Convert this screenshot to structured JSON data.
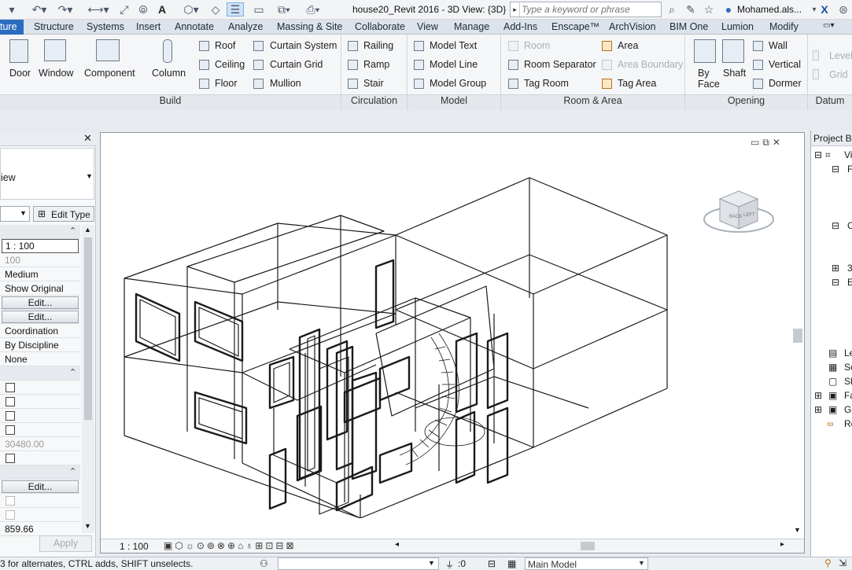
{
  "app": {
    "document_title": "house20_Revit 2016 - 3D View: {3D}",
    "search_placeholder": "Type a keyword or phrase",
    "user_name": "Mohamed.als..."
  },
  "tabs": [
    {
      "label": "ture",
      "active": true
    },
    {
      "label": "Structure"
    },
    {
      "label": "Systems"
    },
    {
      "label": "Insert"
    },
    {
      "label": "Annotate"
    },
    {
      "label": "Analyze"
    },
    {
      "label": "Massing & Site"
    },
    {
      "label": "Collaborate"
    },
    {
      "label": "View"
    },
    {
      "label": "Manage"
    },
    {
      "label": "Add-Ins"
    },
    {
      "label": "Enscape™"
    },
    {
      "label": "ArchVision"
    },
    {
      "label": "BIM One"
    },
    {
      "label": "Lumion"
    },
    {
      "label": "Modify"
    }
  ],
  "ribbon": {
    "build": {
      "title": "Build",
      "large": [
        "Door",
        "Window",
        "Component",
        "Column"
      ],
      "small_a": [
        "Roof",
        "Ceiling",
        "Floor"
      ],
      "small_b": [
        "Curtain System",
        "Curtain Grid",
        "Mullion"
      ]
    },
    "circulation": {
      "title": "Circulation",
      "items": [
        "Railing",
        "Ramp",
        "Stair"
      ]
    },
    "model": {
      "title": "Model",
      "items": [
        "Model Text",
        "Model Line",
        "Model Group"
      ]
    },
    "room_area": {
      "title": "Room & Area",
      "items_a": [
        "Room",
        "Room Separator",
        "Tag Room"
      ],
      "items_b": [
        "Area",
        "Area Boundary",
        "Tag Area"
      ]
    },
    "opening": {
      "title": "Opening",
      "large": [
        "By Face",
        "Shaft"
      ],
      "small": [
        "Wall",
        "Vertical",
        "Dormer"
      ]
    },
    "datum": {
      "title": "Datum",
      "items": [
        "Level",
        "Grid"
      ]
    }
  },
  "properties": {
    "type_label": "iew",
    "edit_type": "Edit Type",
    "rows": [
      {
        "kind": "group"
      },
      {
        "kind": "boxed",
        "value": "1 : 100"
      },
      {
        "kind": "text",
        "value": "100",
        "gray": true
      },
      {
        "kind": "text",
        "value": "Medium"
      },
      {
        "kind": "text",
        "value": "Show Original"
      },
      {
        "kind": "button",
        "value": "Edit..."
      },
      {
        "kind": "button",
        "value": "Edit..."
      },
      {
        "kind": "text",
        "value": "Coordination"
      },
      {
        "kind": "text",
        "value": "By Discipline"
      },
      {
        "kind": "text",
        "value": "None"
      },
      {
        "kind": "group"
      },
      {
        "kind": "check"
      },
      {
        "kind": "check"
      },
      {
        "kind": "check"
      },
      {
        "kind": "check"
      },
      {
        "kind": "text",
        "value": "30480.00",
        "gray": true
      },
      {
        "kind": "check"
      },
      {
        "kind": "group"
      },
      {
        "kind": "button",
        "value": "Edit..."
      },
      {
        "kind": "check",
        "dim": true
      },
      {
        "kind": "check",
        "dim": true
      },
      {
        "kind": "text",
        "value": "859.66"
      }
    ],
    "apply": "Apply"
  },
  "view": {
    "scale": "1 : 100",
    "viewcube": {
      "face_back": "BACK",
      "face_left": "LEFT"
    }
  },
  "browser": {
    "title": "Project Br",
    "items": [
      "Vi",
      "F",
      "C",
      "3",
      "E",
      "Le",
      "Sc",
      "Sh",
      "Fa",
      "Gr",
      "Re"
    ]
  },
  "statusbar": {
    "message": "3 for alternates, CTRL adds, SHIFT unselects.",
    "coord": ":0",
    "model": "Main Model"
  }
}
